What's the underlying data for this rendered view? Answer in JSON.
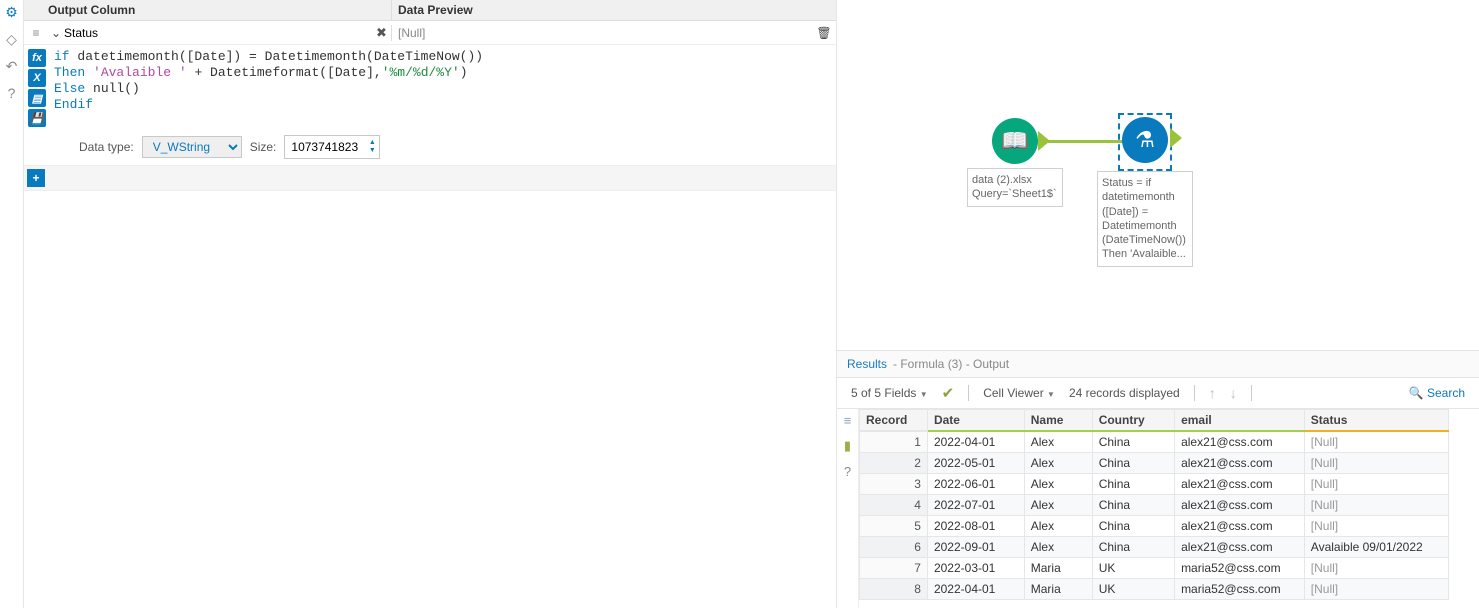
{
  "headers": {
    "output_column": "Output Column",
    "data_preview": "Data Preview"
  },
  "field": {
    "name": "Status",
    "preview": "[Null]"
  },
  "formula": {
    "line1_if": "if",
    "line1_rest": " datetimemonth([Date]) = Datetimemonth(DateTimeNow())",
    "line2_then": "Then",
    "line2_str": " 'Avalaible '",
    "line2_plus": " + Datetimeformat([Date],",
    "line2_fmt": "'%m/%d/%Y'",
    "line2_close": ")",
    "line3_else": "Else",
    "line3_rest": " null()",
    "line4": "Endif"
  },
  "datatype": {
    "label": "Data type:",
    "value": "V_WString",
    "size_label": "Size:",
    "size_value": "1073741823"
  },
  "canvas": {
    "input_node": {
      "line1": "data (2).xlsx",
      "line2": "Query=`Sheet1$`"
    },
    "formula_node": {
      "l1": "Status = if",
      "l2": "datetimemonth",
      "l3": "([Date]) =",
      "l4": "Datetimemonth",
      "l5": "(DateTimeNow())",
      "l6": "Then 'Avalaible..."
    }
  },
  "results": {
    "title": "Results",
    "subtitle": " - Formula (3) - Output",
    "fields_label": "5 of 5 Fields",
    "cell_viewer": "Cell Viewer",
    "records_displayed": "24 records displayed",
    "search": "Search",
    "columns": [
      "Record",
      "Date",
      "Name",
      "Country",
      "email",
      "Status"
    ],
    "rows": [
      {
        "rec": "1",
        "date": "2022-04-01",
        "name": "Alex",
        "country": "China",
        "email": "alex21@css.com",
        "status": "[Null]",
        "isnull": true
      },
      {
        "rec": "2",
        "date": "2022-05-01",
        "name": "Alex",
        "country": "China",
        "email": "alex21@css.com",
        "status": "[Null]",
        "isnull": true
      },
      {
        "rec": "3",
        "date": "2022-06-01",
        "name": "Alex",
        "country": "China",
        "email": "alex21@css.com",
        "status": "[Null]",
        "isnull": true
      },
      {
        "rec": "4",
        "date": "2022-07-01",
        "name": "Alex",
        "country": "China",
        "email": "alex21@css.com",
        "status": "[Null]",
        "isnull": true
      },
      {
        "rec": "5",
        "date": "2022-08-01",
        "name": "Alex",
        "country": "China",
        "email": "alex21@css.com",
        "status": "[Null]",
        "isnull": true
      },
      {
        "rec": "6",
        "date": "2022-09-01",
        "name": "Alex",
        "country": "China",
        "email": "alex21@css.com",
        "status": "Avalaible 09/01/2022",
        "isnull": false
      },
      {
        "rec": "7",
        "date": "2022-03-01",
        "name": "Maria",
        "country": "UK",
        "email": "maria52@css.com",
        "status": "[Null]",
        "isnull": true
      },
      {
        "rec": "8",
        "date": "2022-04-01",
        "name": "Maria",
        "country": "UK",
        "email": "maria52@css.com",
        "status": "[Null]",
        "isnull": true
      }
    ]
  }
}
